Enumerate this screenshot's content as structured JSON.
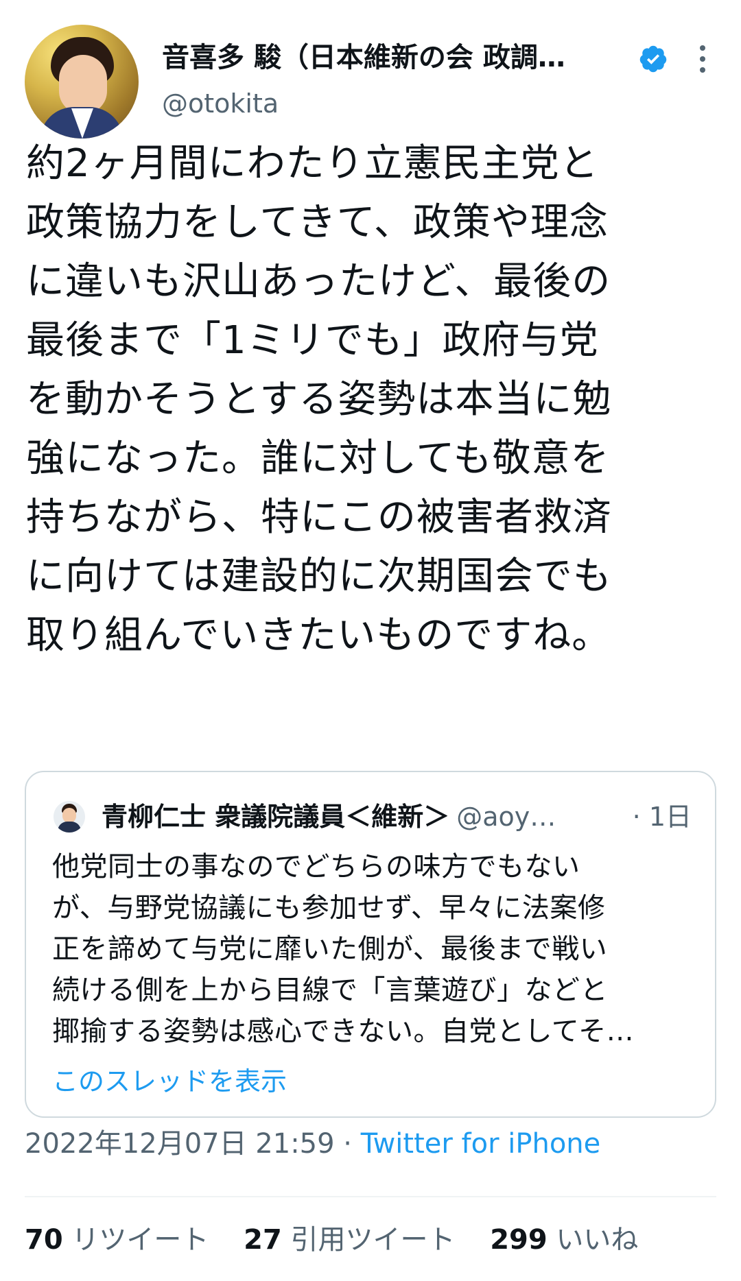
{
  "author": {
    "display_name": "音喜多 駿（日本維新の会 政調…",
    "handle": "@otokita",
    "verified": true,
    "avatar_icon": "user-avatar",
    "more_icon": "more-vertical-icon"
  },
  "tweet": {
    "text": "約2ヶ月間にわたり立憲民主党と\n政策協力をしてきて、政策や理念\nに違いも沢山あったけど、最後の\n最後まで「1ミリでも」政府与党\nを動かそうとする姿勢は本当に勉\n強になった。誰に対しても敬意を\n持ちながら、特にこの被害者救済\nに向けては建設的に次期国会でも\n取り組んでいきたいものですね。"
  },
  "quote": {
    "name": "青柳仁士 衆議院議員＜維新＞",
    "handle": "@aoy…",
    "time": "· 1日",
    "text": "他党同士の事なのでどちらの味方でもない\nが、与野党協議にも参加せず、早々に法案修\n正を諦めて与党に靡いた側が、最後まで戦い\n続ける側を上から目線で「言葉遊び」などと\n揶揄する姿勢は感心できない。自党としてそ…",
    "show_thread": "このスレッドを表示"
  },
  "meta": {
    "datetime": "2022年12月07日 21:59",
    "separator": " · ",
    "source": "Twitter for iPhone"
  },
  "stats": {
    "retweets_count": "70",
    "retweets_label": " リツイート",
    "quotes_count": "27",
    "quotes_label": " 引用ツイート",
    "likes_count": "299",
    "likes_label": " いいね"
  },
  "colors": {
    "accent": "#1d9bf0",
    "secondary_text": "#536471",
    "border": "#cfd9de"
  }
}
